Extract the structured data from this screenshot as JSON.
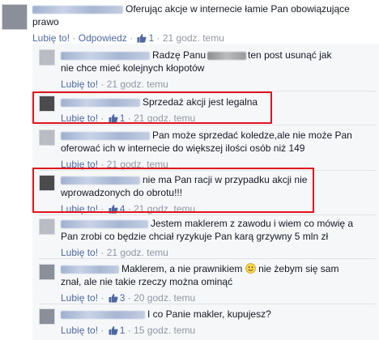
{
  "comments": [
    {
      "text": "Oferując akcje w internecie łamie Pan obowiązujące prawo",
      "line1": "Oferując akcje w internecie łamie Pan obowiązujące",
      "line2": "prawo",
      "like_label": "Lubię to!",
      "reply_label": "Odpowiedz",
      "likes": "1",
      "time": "21 godz. temu"
    },
    {
      "line1_a": "Radzę Panu",
      "line1_b": "ten post usunąć jak",
      "line2": "nie chce mieć kolejnych kłopotów",
      "like_label": "Lubię to!",
      "time": "21 godz. temu"
    },
    {
      "text": "Sprzedaż akcji jest legalna",
      "like_label": "Lubię to!",
      "likes": "1",
      "time": "21 godz. temu"
    },
    {
      "line1": "Pan może sprzedać koledze,ale nie może Pan",
      "line2": "oferować ich w internecie do większej ilości osób niż 149",
      "like_label": "Lubię to!",
      "time": "21 godz. temu"
    },
    {
      "line1": "nie ma Pan racji w przypadku akcji nie",
      "line2": "wprowadzonych do obrotu!!!",
      "like_label": "Lubię to!",
      "likes": "4",
      "time": "21 godz. temu"
    },
    {
      "line1": "Jestem maklerem z zawodu i wiem co mówię a",
      "line2": "Pan zrobi co będzie chciał ryzykuje Pan karą grzywny 5 mln zł",
      "like_label": "Lubię to!",
      "time": "21 godz. temu"
    },
    {
      "line1_a": "Maklerem, a nie prawnikiem",
      "line1_b": "nie żebym się sam",
      "line2": "znał, ale nie takie rzeczy można ominąć",
      "like_label": "Lubię to!",
      "likes": "3",
      "time": "20 godz. temu"
    },
    {
      "text": "I co Panie makler, kupujesz?",
      "like_label": "Lubię to!",
      "likes": "1",
      "time": "15 godz. temu"
    }
  ],
  "colors": {
    "link": "#4e69a2",
    "meta": "#9197a3",
    "highlight": "#e0141e"
  }
}
